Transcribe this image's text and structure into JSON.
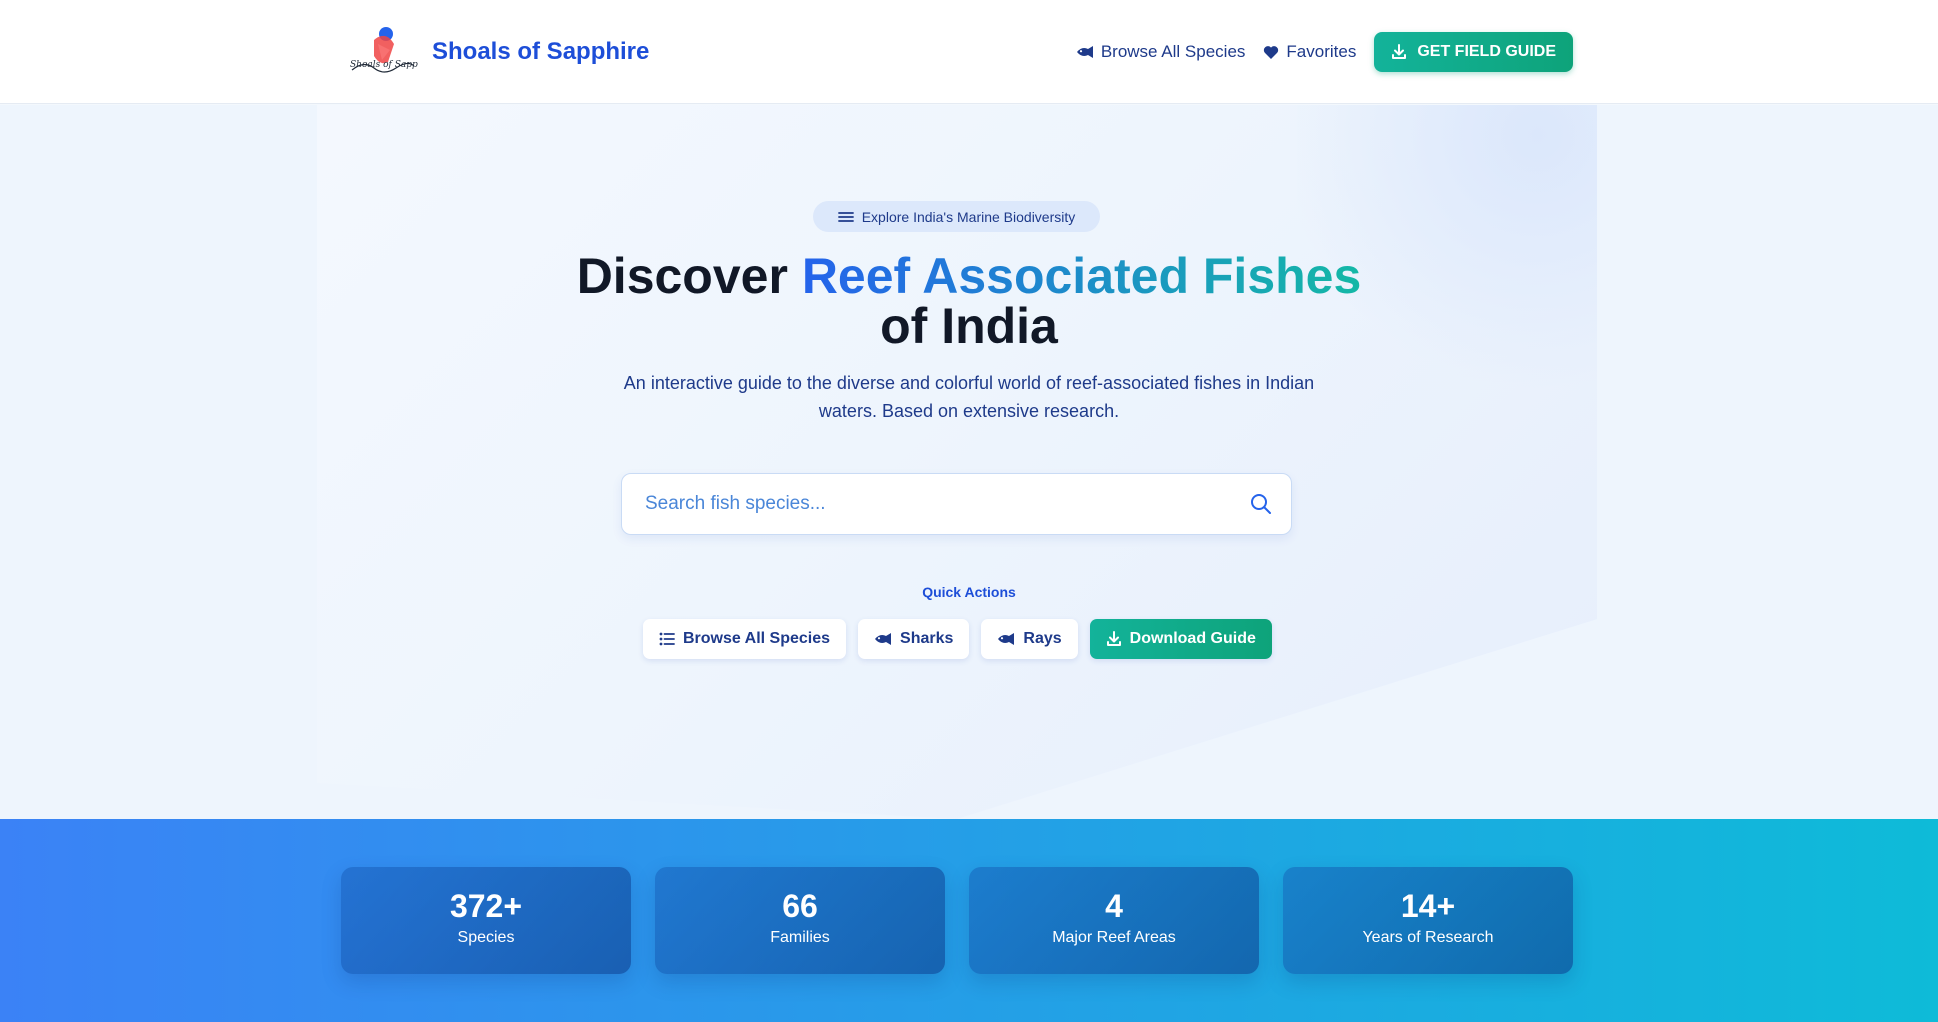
{
  "header": {
    "brand_name": "Shoals of Sapphire",
    "logo_text": "Shoals of Sapphire",
    "nav": [
      {
        "label": "Browse All Species",
        "icon": "fish-icon"
      },
      {
        "label": "Favorites",
        "icon": "heart-icon"
      }
    ],
    "cta_label": "GET FIELD GUIDE",
    "cta_icon": "download-icon"
  },
  "hero": {
    "badge": "Explore India's Marine Biodiversity",
    "title_part1": "Discover ",
    "title_accent": "Reef Associated Fishes",
    "title_part2": "of India",
    "subtitle": "An interactive guide to the diverse and colorful world of reef-associated fishes in Indian waters. Based on extensive research.",
    "search_placeholder": "Search fish species...",
    "quick_actions_label": "Quick Actions",
    "quick_actions": [
      {
        "label": "Browse All Species",
        "icon": "list-icon"
      },
      {
        "label": "Sharks",
        "icon": "fish-icon"
      },
      {
        "label": "Rays",
        "icon": "fish-icon"
      },
      {
        "label": "Download Guide",
        "icon": "download-icon"
      }
    ]
  },
  "stats": [
    {
      "value": "372+",
      "label": "Species"
    },
    {
      "value": "66",
      "label": "Families"
    },
    {
      "value": "4",
      "label": "Major Reef Areas"
    },
    {
      "value": "14+",
      "label": "Years of Research"
    }
  ],
  "colors": {
    "brand": "#1d4ed8",
    "accent_green": "#10a37f",
    "stats_gradient_start": "#3b82f6",
    "stats_gradient_end": "#0ebbd8"
  }
}
